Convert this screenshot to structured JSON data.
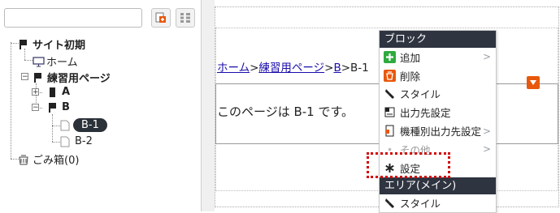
{
  "left_panel": {
    "search": {
      "value": "",
      "placeholder": ""
    },
    "tree": {
      "root_label": "サイト初期",
      "home_label": "ホーム",
      "practice_label": "練習用ページ",
      "a_label": "A",
      "b_label": "B",
      "b1_label": "B-1",
      "b2_label": "B-2",
      "trash_label": "ごみ箱(0)",
      "expand_symbol": "+",
      "collapse_symbol": "−"
    }
  },
  "main": {
    "breadcrumb": {
      "home": "ホーム",
      "practice": "練習用ページ",
      "b": "B",
      "b1": "B-1",
      "separator": ">"
    },
    "content_text": "このページは B-1 です。"
  },
  "context_menu": {
    "block_header": "ブロック",
    "items": [
      {
        "label": "追加",
        "icon": "plus-icon",
        "submenu": true
      },
      {
        "label": "削除",
        "icon": "trash-icon",
        "submenu": false
      },
      {
        "label": "スタイル",
        "icon": "brush-icon",
        "submenu": false
      },
      {
        "label": "出力先設定",
        "icon": "output-icon",
        "submenu": false
      },
      {
        "label": "機種別出力先設定",
        "icon": "device-icon",
        "submenu": true
      },
      {
        "label": "その他",
        "icon": "dot-icon",
        "submenu": true
      },
      {
        "label": "設定",
        "icon": "asterisk-icon",
        "submenu": false
      }
    ],
    "area_header": "エリア(メイン)",
    "area_items": [
      {
        "label": "スタイル",
        "icon": "brush-icon"
      }
    ],
    "submenu_arrow": ">"
  },
  "colors": {
    "menu_header_bg": "#2e3440",
    "highlight_border": "#d20000",
    "plus_green": "#2faa3e",
    "trash_orange": "#e8580c",
    "link_blue": "#1a0dab"
  }
}
